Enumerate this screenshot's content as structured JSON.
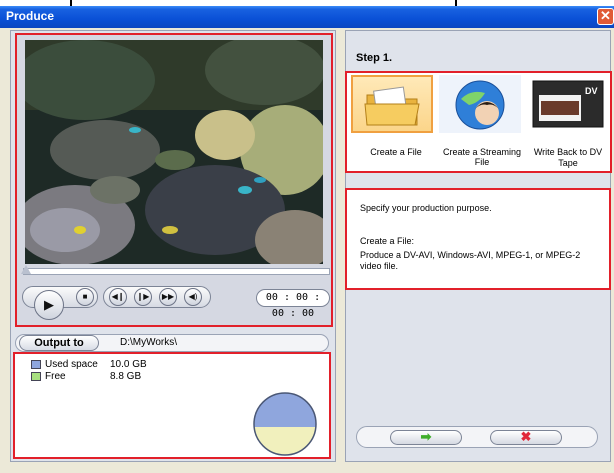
{
  "window": {
    "title": "Produce",
    "close_glyph": "✕"
  },
  "player": {
    "timecode": "00 : 00 : 00 : 00",
    "controls": [
      {
        "name": "play-icon",
        "glyph": "▶"
      },
      {
        "name": "stop-icon",
        "glyph": "■"
      },
      {
        "name": "previous-frame-icon",
        "glyph": "◀❙"
      },
      {
        "name": "next-frame-icon",
        "glyph": "❙▶"
      },
      {
        "name": "fast-forward-icon",
        "glyph": "▶▶"
      },
      {
        "name": "volume-icon",
        "glyph": "◀)"
      }
    ]
  },
  "output": {
    "button_label": "Output to",
    "path": "D:\\MyWorks\\"
  },
  "disk": {
    "used_label": "Used space",
    "used_value": "10.0  GB",
    "used_color": "#8fa6dd",
    "free_label": "Free",
    "free_value": "8.8  GB",
    "free_color": "#a8e080"
  },
  "step": {
    "title": "Step 1."
  },
  "options": [
    {
      "label": "Create a File",
      "icon": "folder-icon"
    },
    {
      "label": "Create a Streaming File",
      "icon": "globe-icon"
    },
    {
      "label": "Write Back to DV Tape",
      "icon": "dv-tape-icon",
      "badge": "DV"
    }
  ],
  "description": {
    "intro": "Specify your production purpose.",
    "heading": "Create a File:",
    "body": "Produce a DV-AVI, Windows-AVI, MPEG-1, or MPEG-2 video file."
  },
  "actions": {
    "next_glyph": "➡",
    "cancel_glyph": "✖",
    "next_color": "#3fae2a",
    "cancel_color": "#e0283a"
  }
}
